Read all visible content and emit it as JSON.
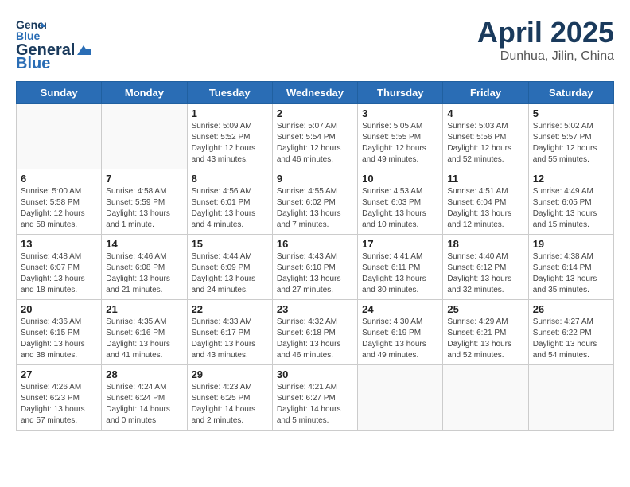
{
  "header": {
    "logo_general": "General",
    "logo_blue": "Blue",
    "month_title": "April 2025",
    "subtitle": "Dunhua, Jilin, China"
  },
  "weekdays": [
    "Sunday",
    "Monday",
    "Tuesday",
    "Wednesday",
    "Thursday",
    "Friday",
    "Saturday"
  ],
  "weeks": [
    [
      {
        "day": "",
        "info": ""
      },
      {
        "day": "",
        "info": ""
      },
      {
        "day": "1",
        "info": "Sunrise: 5:09 AM\nSunset: 5:52 PM\nDaylight: 12 hours and 43 minutes."
      },
      {
        "day": "2",
        "info": "Sunrise: 5:07 AM\nSunset: 5:54 PM\nDaylight: 12 hours and 46 minutes."
      },
      {
        "day": "3",
        "info": "Sunrise: 5:05 AM\nSunset: 5:55 PM\nDaylight: 12 hours and 49 minutes."
      },
      {
        "day": "4",
        "info": "Sunrise: 5:03 AM\nSunset: 5:56 PM\nDaylight: 12 hours and 52 minutes."
      },
      {
        "day": "5",
        "info": "Sunrise: 5:02 AM\nSunset: 5:57 PM\nDaylight: 12 hours and 55 minutes."
      }
    ],
    [
      {
        "day": "6",
        "info": "Sunrise: 5:00 AM\nSunset: 5:58 PM\nDaylight: 12 hours and 58 minutes."
      },
      {
        "day": "7",
        "info": "Sunrise: 4:58 AM\nSunset: 5:59 PM\nDaylight: 13 hours and 1 minute."
      },
      {
        "day": "8",
        "info": "Sunrise: 4:56 AM\nSunset: 6:01 PM\nDaylight: 13 hours and 4 minutes."
      },
      {
        "day": "9",
        "info": "Sunrise: 4:55 AM\nSunset: 6:02 PM\nDaylight: 13 hours and 7 minutes."
      },
      {
        "day": "10",
        "info": "Sunrise: 4:53 AM\nSunset: 6:03 PM\nDaylight: 13 hours and 10 minutes."
      },
      {
        "day": "11",
        "info": "Sunrise: 4:51 AM\nSunset: 6:04 PM\nDaylight: 13 hours and 12 minutes."
      },
      {
        "day": "12",
        "info": "Sunrise: 4:49 AM\nSunset: 6:05 PM\nDaylight: 13 hours and 15 minutes."
      }
    ],
    [
      {
        "day": "13",
        "info": "Sunrise: 4:48 AM\nSunset: 6:07 PM\nDaylight: 13 hours and 18 minutes."
      },
      {
        "day": "14",
        "info": "Sunrise: 4:46 AM\nSunset: 6:08 PM\nDaylight: 13 hours and 21 minutes."
      },
      {
        "day": "15",
        "info": "Sunrise: 4:44 AM\nSunset: 6:09 PM\nDaylight: 13 hours and 24 minutes."
      },
      {
        "day": "16",
        "info": "Sunrise: 4:43 AM\nSunset: 6:10 PM\nDaylight: 13 hours and 27 minutes."
      },
      {
        "day": "17",
        "info": "Sunrise: 4:41 AM\nSunset: 6:11 PM\nDaylight: 13 hours and 30 minutes."
      },
      {
        "day": "18",
        "info": "Sunrise: 4:40 AM\nSunset: 6:12 PM\nDaylight: 13 hours and 32 minutes."
      },
      {
        "day": "19",
        "info": "Sunrise: 4:38 AM\nSunset: 6:14 PM\nDaylight: 13 hours and 35 minutes."
      }
    ],
    [
      {
        "day": "20",
        "info": "Sunrise: 4:36 AM\nSunset: 6:15 PM\nDaylight: 13 hours and 38 minutes."
      },
      {
        "day": "21",
        "info": "Sunrise: 4:35 AM\nSunset: 6:16 PM\nDaylight: 13 hours and 41 minutes."
      },
      {
        "day": "22",
        "info": "Sunrise: 4:33 AM\nSunset: 6:17 PM\nDaylight: 13 hours and 43 minutes."
      },
      {
        "day": "23",
        "info": "Sunrise: 4:32 AM\nSunset: 6:18 PM\nDaylight: 13 hours and 46 minutes."
      },
      {
        "day": "24",
        "info": "Sunrise: 4:30 AM\nSunset: 6:19 PM\nDaylight: 13 hours and 49 minutes."
      },
      {
        "day": "25",
        "info": "Sunrise: 4:29 AM\nSunset: 6:21 PM\nDaylight: 13 hours and 52 minutes."
      },
      {
        "day": "26",
        "info": "Sunrise: 4:27 AM\nSunset: 6:22 PM\nDaylight: 13 hours and 54 minutes."
      }
    ],
    [
      {
        "day": "27",
        "info": "Sunrise: 4:26 AM\nSunset: 6:23 PM\nDaylight: 13 hours and 57 minutes."
      },
      {
        "day": "28",
        "info": "Sunrise: 4:24 AM\nSunset: 6:24 PM\nDaylight: 14 hours and 0 minutes."
      },
      {
        "day": "29",
        "info": "Sunrise: 4:23 AM\nSunset: 6:25 PM\nDaylight: 14 hours and 2 minutes."
      },
      {
        "day": "30",
        "info": "Sunrise: 4:21 AM\nSunset: 6:27 PM\nDaylight: 14 hours and 5 minutes."
      },
      {
        "day": "",
        "info": ""
      },
      {
        "day": "",
        "info": ""
      },
      {
        "day": "",
        "info": ""
      }
    ]
  ]
}
